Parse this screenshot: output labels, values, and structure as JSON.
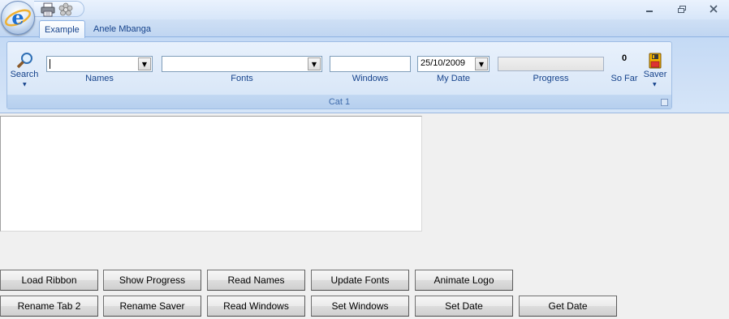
{
  "tabs": [
    {
      "label": "Example",
      "active": true
    },
    {
      "label": "Anele Mbanga",
      "active": false
    }
  ],
  "window_buttons": [
    "minimize",
    "restore",
    "close"
  ],
  "quick_access": [
    "print-icon",
    "flower-icon"
  ],
  "ribbon": {
    "group_caption": "Cat 1",
    "search_label": "Search",
    "names_label": "Names",
    "names_value": "",
    "fonts_label": "Fonts",
    "fonts_value": "",
    "windows_label": "Windows",
    "windows_value": "",
    "date_label": "My Date",
    "date_value": "25/10/2009",
    "progress_label": "Progress",
    "progress_value": 0,
    "sofar_value": "0",
    "sofar_label": "So Far",
    "saver_label": "Saver"
  },
  "buttons": {
    "load_ribbon": "Load Ribbon",
    "show_progress": "Show Progress",
    "read_names": "Read Names",
    "update_fonts": "Update Fonts",
    "animate_logo": "Animate Logo",
    "rename_tab2": "Rename Tab 2",
    "rename_saver": "Rename Saver",
    "read_windows": "Read Windows",
    "set_windows": "Set Windows",
    "set_date": "Set Date",
    "get_date": "Get Date"
  },
  "colors": {
    "ribbon_text": "#15428b",
    "ribbon_bg": "#cfe0f6",
    "window_bg": "#f0f0f0"
  }
}
